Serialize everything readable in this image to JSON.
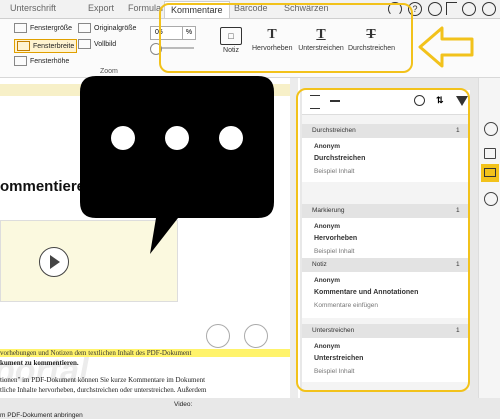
{
  "tabs": [
    "Unterschrift",
    "Export",
    "Formular",
    "Kommentare",
    "Barcode",
    "Schwärzen"
  ],
  "ribbon": {
    "zoom_options": {
      "fenstergroesse": "Fenstergröße",
      "fensterbreite": "Fensterbreite",
      "fensterhoehe": "Fensterhöhe",
      "originalgroesse": "Originalgröße",
      "vollbild": "Vollbild"
    },
    "zoom_value": "05",
    "zoom_unit": "%",
    "zoom_group_label": "Zoom",
    "comment_buttons": [
      "Notiz",
      "Hervorheben",
      "Unterstreichen",
      "Durchstreichen"
    ]
  },
  "document": {
    "heading": "ommentieren",
    "video_label": "Video:",
    "caption": "m PDF-Dokument anbringen",
    "highlight_text": "vorhebungen und Notizen dem textlichen Inhalt des PDF-Dokument",
    "bold_line": "kument zu kommentieren.",
    "body_lines": [
      "tionen\" im PDF-Dokument können Sie kurze Kommentare im Dokument",
      "tliche Inhalte hervorheben, durchstreichen oder unterstreichen. Außerdem"
    ],
    "watermark": "portal"
  },
  "panel": {
    "sections": [
      {
        "label": "Durchstreichen",
        "count": "1",
        "author": "Anonym",
        "type": "Durchstreichen",
        "detail": "Beispiel Inhalt"
      },
      {
        "label": "Markierung",
        "count": "1",
        "author": "Anonym",
        "type": "Hervorheben",
        "detail": "Beispiel Inhalt"
      },
      {
        "label": "Notiz",
        "count": "1",
        "author": "Anonym",
        "type": "Kommentare und Annotationen",
        "detail": "Kommentare einfügen"
      },
      {
        "label": "Unterstreichen",
        "count": "1",
        "author": "Anonym",
        "type": "Unterstreichen",
        "detail": "Beispiel Inhalt"
      }
    ]
  },
  "colors": {
    "annotation_yellow": "#f2c21b",
    "highlight": "#fff36b"
  }
}
